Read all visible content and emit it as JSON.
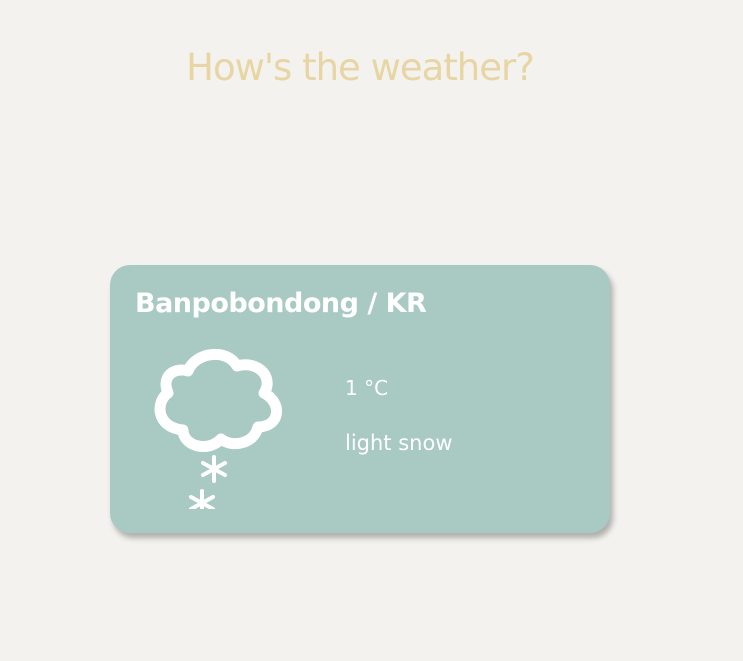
{
  "header": {
    "title": "How's the weather?"
  },
  "weather": {
    "location": "Banpobondong / KR",
    "temperature": "1 °C",
    "description": "light snow",
    "icon": "cloud-snow-icon"
  },
  "colors": {
    "background": "#f3f2ee",
    "title": "#e7d6a4",
    "card": "#a9c9c3",
    "card_text": "#ffffff"
  }
}
